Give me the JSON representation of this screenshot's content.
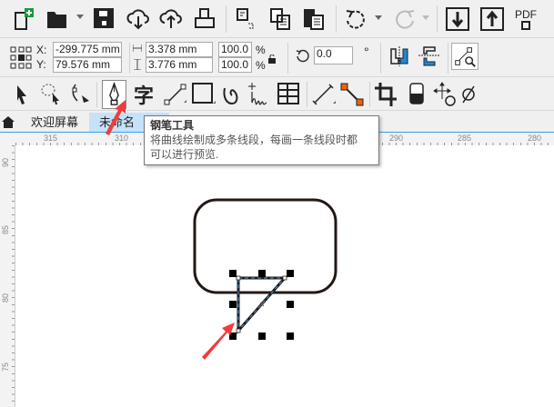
{
  "toolbar_standard": {
    "icons": [
      "new-document",
      "open",
      "save",
      "import-cloud",
      "export-cloud",
      "print",
      "copy-properties",
      "copy",
      "paste",
      "undo",
      "redo",
      "import",
      "export",
      "publish-pdf"
    ],
    "pdf_label": "PDF"
  },
  "property_bar": {
    "x_label": "X:",
    "y_label": "Y:",
    "x_value": "-299.775 mm",
    "y_value": "79.576 mm",
    "width_value": "3.378 mm",
    "height_value": "3.776 mm",
    "scale_x": "100.0",
    "scale_y": "100.0",
    "percent": "%",
    "rotation": "0.0",
    "degree": "°"
  },
  "tabs": {
    "home_label": "欢迎屏幕",
    "doc_label": "未命名"
  },
  "tooltip": {
    "title": "钢笔工具",
    "line1": "将曲线绘制成多条线段，每画一条线段时都",
    "line2": "可以进行预览."
  },
  "ruler": {
    "h": [
      "315",
      "310",
      "290",
      "285",
      "280"
    ],
    "v": [
      "90",
      "85",
      "80",
      "75"
    ]
  },
  "colors": {
    "accent": "#3aa0e8",
    "arrow": "#f03c3c"
  }
}
